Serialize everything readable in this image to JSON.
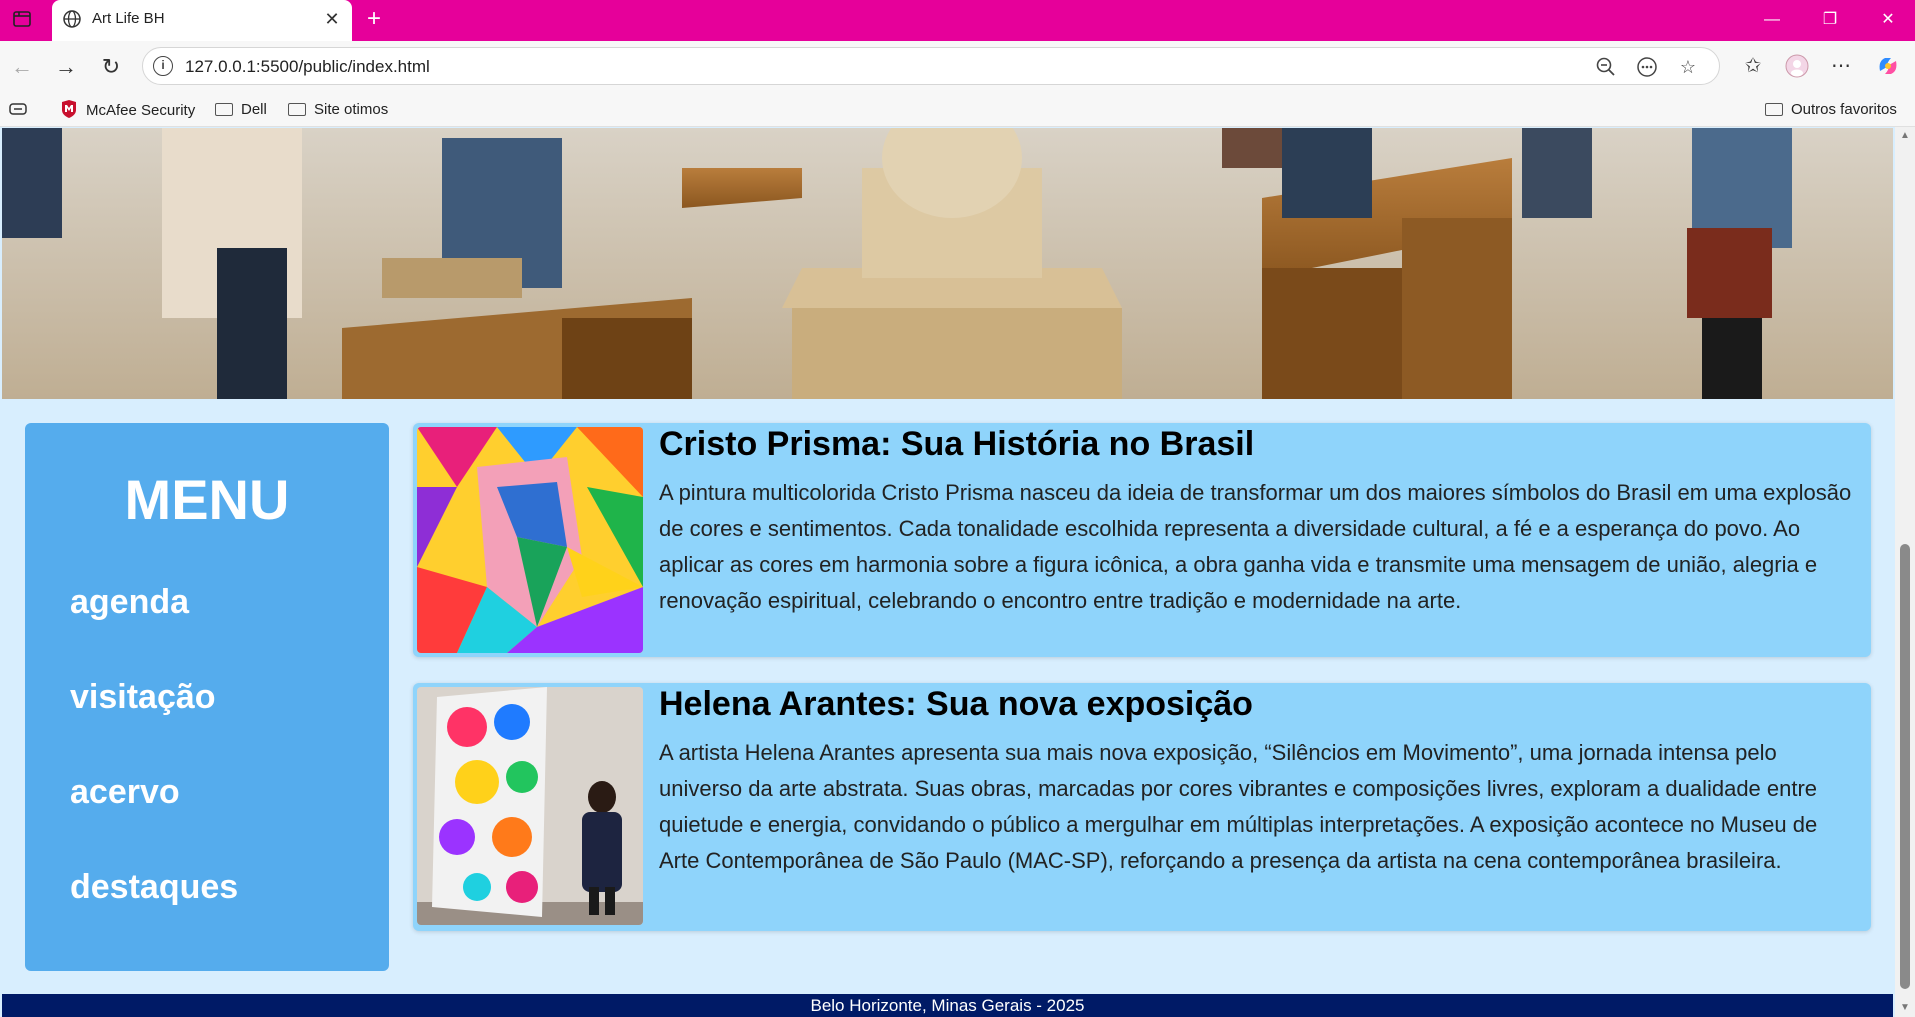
{
  "browser": {
    "tab_title": "Art Life BH",
    "url": "127.0.0.1:5500/public/index.html",
    "bookmarks": [
      "McAfee Security",
      "Dell",
      "Site otimos"
    ],
    "other_favorites": "Outros favoritos"
  },
  "page": {
    "menu": {
      "title": "MENU",
      "items": [
        "agenda",
        "visitação",
        "acervo",
        "destaques"
      ]
    },
    "articles": [
      {
        "title": "Cristo Prisma: Sua História no Brasil",
        "text": "A pintura multicolorida Cristo Prisma nasceu da ideia de transformar um dos maiores símbolos do Brasil em uma explosão de cores e sentimentos. Cada tonalidade escolhida representa a diversidade cultural, a fé e a esperança do povo. Ao aplicar as cores em harmonia sobre a figura icônica, a obra ganha vida e transmite uma mensagem de união, alegria e renovação espiritual, celebrando o encontro entre tradição e modernidade na arte."
      },
      {
        "title": "Helena Arantes: Sua nova exposição",
        "text": "A artista Helena Arantes apresenta sua mais nova exposição, “Silêncios em Movimento”, uma jornada intensa pelo universo da arte abstrata. Suas obras, marcadas por cores vibrantes e composições livres, exploram a dualidade entre quietude e energia, convidando o público a mergulhar em múltiplas interpretações. A exposição acontece no Museu de Arte Contemporânea de São Paulo (MAC-SP), reforçando a presença da artista na cena contemporânea brasileira."
      }
    ],
    "footer": "Belo Horizonte, Minas Gerais - 2025"
  },
  "colors": {
    "titlebar": "#e6009a",
    "menu_bg": "#55aced",
    "card_bg": "#8fd4fb",
    "page_bg": "#d8eefe",
    "footer_bg": "#001a66"
  }
}
